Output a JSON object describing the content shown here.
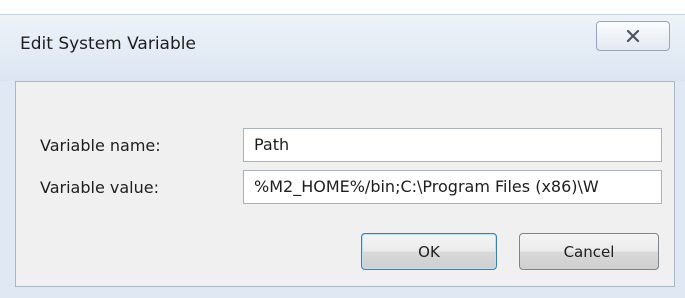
{
  "dialog": {
    "title": "Edit System Variable",
    "close_icon": "close-x-icon"
  },
  "form": {
    "name_label": "Variable name:",
    "name_value": "Path",
    "value_label": "Variable value:",
    "value_value": "%M2_HOME%/bin;C:\\Program Files (x86)\\W"
  },
  "buttons": {
    "ok_label": "OK",
    "cancel_label": "Cancel"
  },
  "colors": {
    "frame": "#dfe8f3",
    "panel": "#f0f0f0",
    "default_button_border": "#3c7fb1"
  }
}
